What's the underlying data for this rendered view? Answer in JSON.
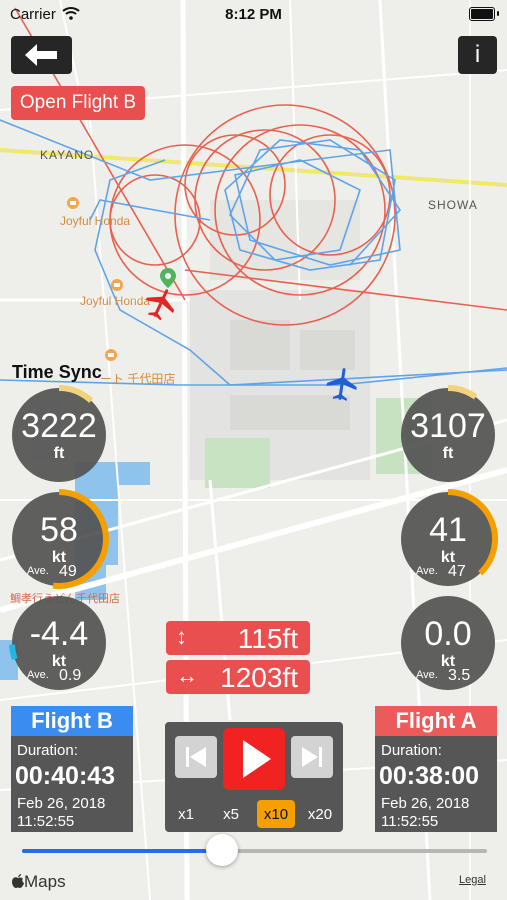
{
  "status_bar": {
    "carrier": "Carrier",
    "time": "8:12 PM"
  },
  "map": {
    "labels": {
      "kayano": "KAYANO",
      "showa": "SHOWA",
      "joyful1": "Joyful Honda",
      "joyful2": "Joyful Honda",
      "store": "ート 千代田店",
      "udon": "鯛孝行うどん千代田店"
    },
    "colors": {
      "flight_a": "#e9604f",
      "flight_b": "#5fa4e8",
      "road": "#f0e85a"
    }
  },
  "controls": {
    "back_icon": "back-arrow-icon",
    "info_label": "i",
    "open_flight": "Open Flight B",
    "time_sync": "Time Sync"
  },
  "left_gauges": {
    "altitude": {
      "value": "3222",
      "unit": "ft",
      "arc_fraction": 0.12
    },
    "speed": {
      "value": "58",
      "unit": "kt",
      "ave_label": "Ave.",
      "ave_value": "49",
      "arc_fraction": 0.52
    },
    "vspeed": {
      "value": "-4.4",
      "unit": "kt",
      "ave_label": "Ave.",
      "ave_value": "0.9",
      "arc_fraction": 0.05
    }
  },
  "right_gauges": {
    "altitude": {
      "value": "3107",
      "unit": "ft",
      "arc_fraction": 0.1
    },
    "speed": {
      "value": "41",
      "unit": "kt",
      "ave_label": "Ave.",
      "ave_value": "47",
      "arc_fraction": 0.38
    },
    "vspeed": {
      "value": "0.0",
      "unit": "kt",
      "ave_label": "Ave.",
      "ave_value": "3.5",
      "arc_fraction": 0
    }
  },
  "differences": {
    "vertical_icon": "↕",
    "vertical": "115ft",
    "horizontal_icon": "↔",
    "horizontal": "1203ft"
  },
  "flight_b": {
    "title": "Flight B",
    "color": "#3a8cf0",
    "duration_label": "Duration:",
    "duration": "00:40:43",
    "date": "Feb 26, 2018",
    "time": "11:52:55"
  },
  "flight_a": {
    "title": "Flight A",
    "color": "#ec5a5a",
    "duration_label": "Duration:",
    "duration": "00:38:00",
    "date": "Feb 26, 2018",
    "time": "11:52:55"
  },
  "player": {
    "speeds": [
      "x1",
      "x5",
      "x10",
      "x20"
    ],
    "selected_speed": "x10"
  },
  "timeline": {
    "position_fraction": 0.43
  },
  "footer": {
    "maps_logo": "Maps",
    "legal": "Legal"
  }
}
